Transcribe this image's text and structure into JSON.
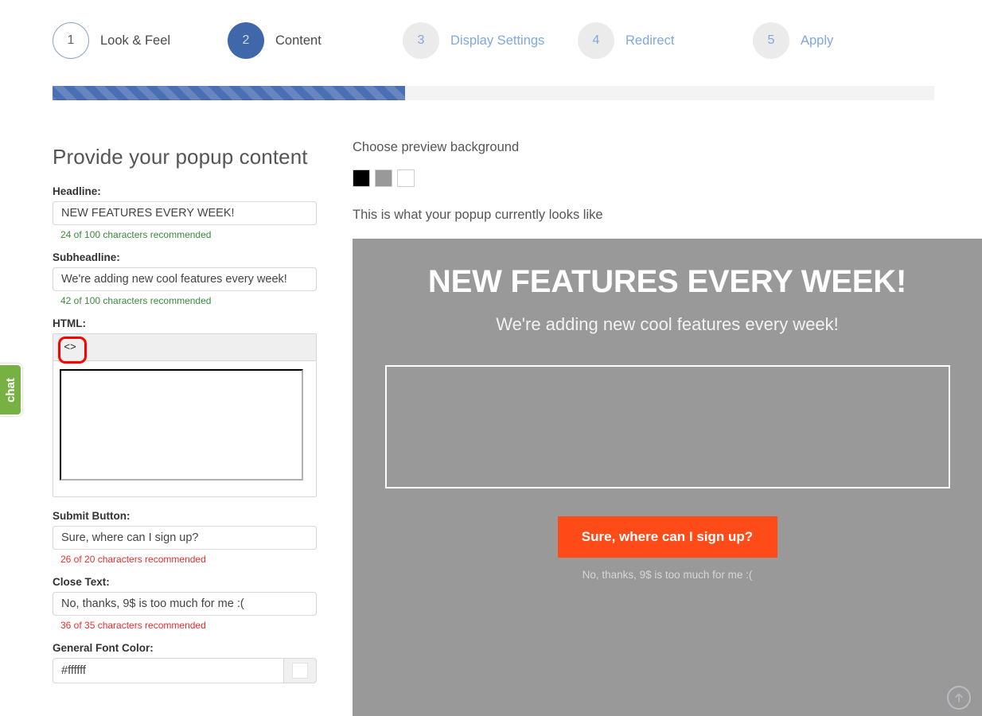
{
  "wizard": {
    "steps": [
      {
        "number": "1",
        "label": "Look & Feel",
        "state": "done"
      },
      {
        "number": "2",
        "label": "Content",
        "state": "active"
      },
      {
        "number": "3",
        "label": "Display Settings",
        "state": "todo"
      },
      {
        "number": "4",
        "label": "Redirect",
        "state": "todo"
      },
      {
        "number": "5",
        "label": "Apply",
        "state": "todo"
      }
    ],
    "progress_percent": 40,
    "progress_fill_color": "#4a6fb4",
    "progress_track_color": "#f3f3f4",
    "active_color": "#4167ab"
  },
  "form": {
    "title": "Provide your popup content",
    "headline": {
      "label": "Headline:",
      "value": "NEW FEATURES EVERY WEEK!",
      "hint": "24 of 100 characters recommended",
      "hint_state": "ok"
    },
    "subheadline": {
      "label": "Subheadline:",
      "value": "We're adding new cool features every week!",
      "hint": "42 of 100 characters recommended",
      "hint_state": "ok"
    },
    "html": {
      "label": "HTML:",
      "value": "",
      "toolbar_icon": "code-icon"
    },
    "submit_button": {
      "label": "Submit Button:",
      "value": "Sure, where can I sign up?",
      "hint": "26 of 20 characters recommended",
      "hint_state": "warn"
    },
    "close_text": {
      "label": "Close Text:",
      "value": "No, thanks, 9$ is too much for me :(",
      "hint": "36 of 35 characters recommended",
      "hint_state": "warn"
    },
    "general_font_color": {
      "label": "General Font Color:",
      "value": "#ffffff",
      "swatch_color": "#ffffff"
    }
  },
  "preview": {
    "background_heading": "Choose preview background",
    "swatches": [
      {
        "name": "black-background-swatch",
        "color": "#000000"
      },
      {
        "name": "gray-background-swatch",
        "color": "#999999"
      },
      {
        "name": "white-background-swatch",
        "color": "#ffffff"
      }
    ],
    "selected_background": "#999999",
    "caption": "This is what your popup currently looks like",
    "popup": {
      "headline": "NEW FEATURES EVERY WEEK!",
      "subheadline": "We're adding new cool features every week!",
      "html_content": "",
      "submit_label": "Sure, where can I sign up?",
      "submit_color": "#ff4b18",
      "close_text": "No, thanks, 9$ is too much for me :(",
      "font_color": "#ffffff"
    }
  },
  "chat_tab": {
    "label": "chat",
    "color": "#77b043"
  },
  "scroll_top": {
    "icon": "arrow-up-icon"
  }
}
